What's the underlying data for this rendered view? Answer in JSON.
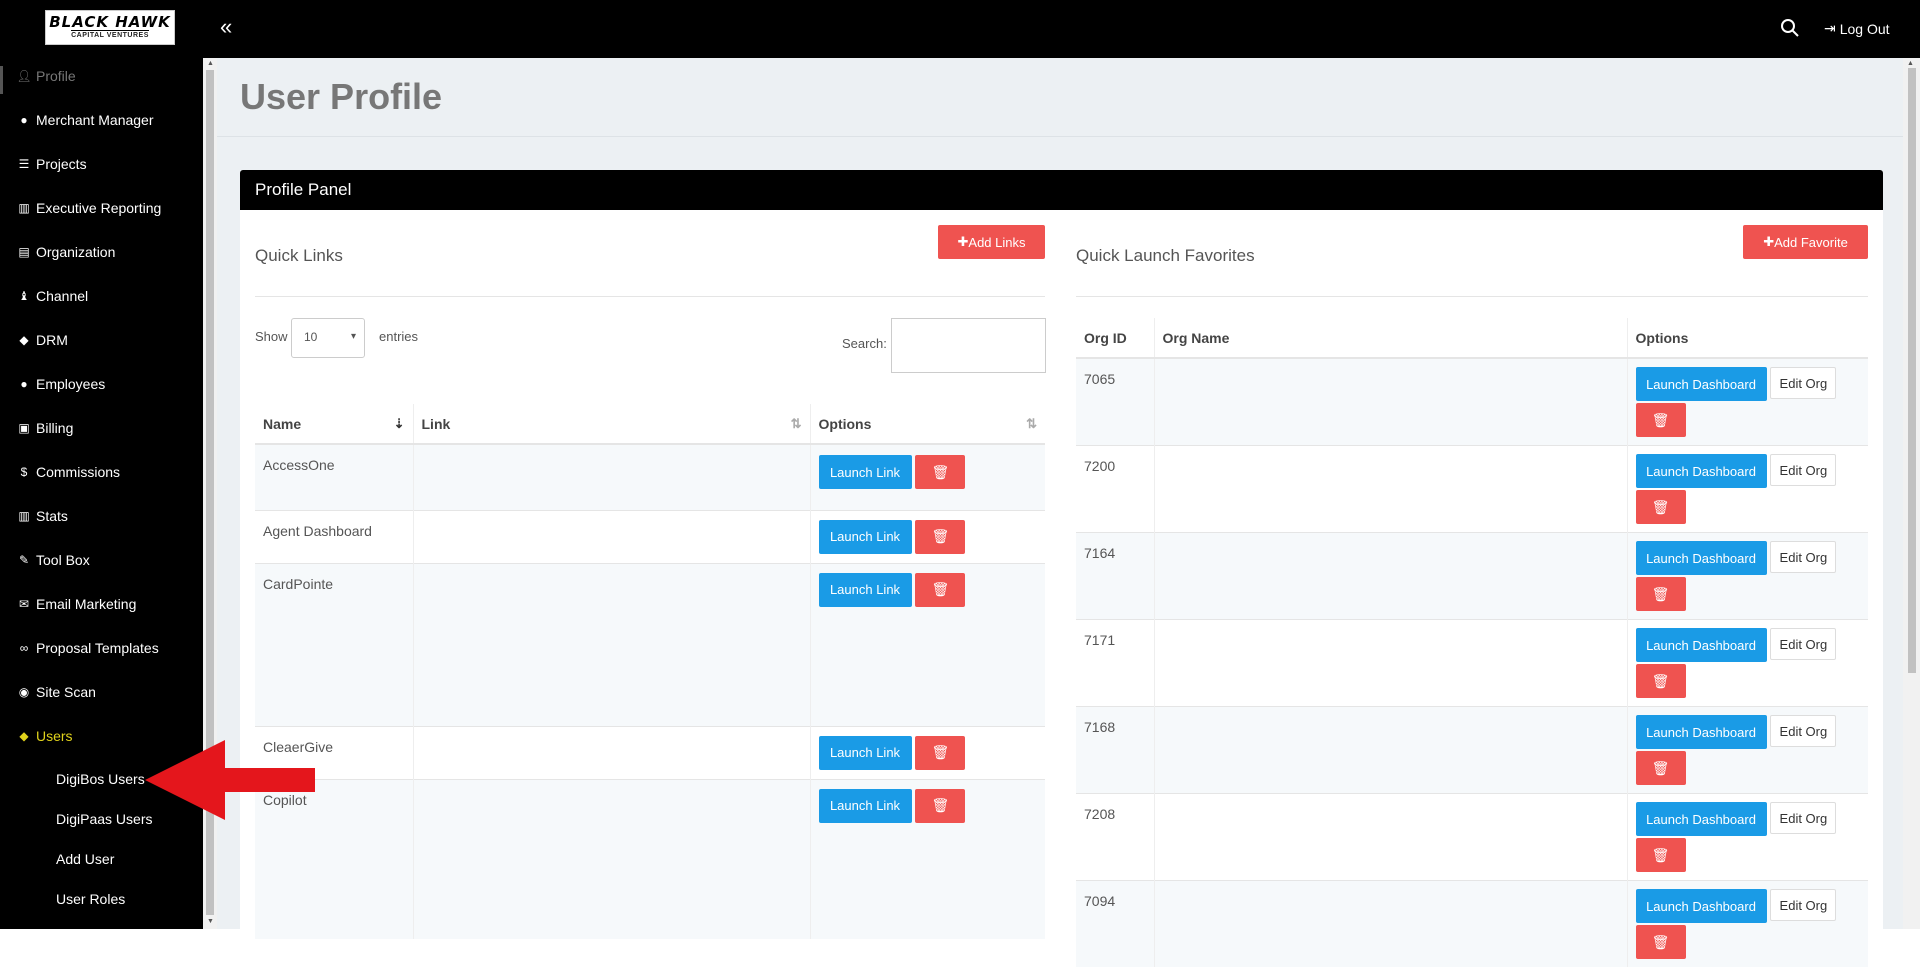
{
  "topbar": {
    "logo_line1": "BLACK HAWK",
    "logo_line2": "CAPITAL VENTURES",
    "collapse_glyph": "«",
    "logout_label": "Log Out"
  },
  "sidebar": {
    "items": [
      {
        "label": "Profile",
        "icon": "user-icon"
      },
      {
        "label": "Merchant Manager",
        "icon": "user-icon"
      },
      {
        "label": "Projects",
        "icon": "tasks-icon"
      },
      {
        "label": "Executive Reporting",
        "icon": "bar-chart-icon"
      },
      {
        "label": "Organization",
        "icon": "building-icon"
      },
      {
        "label": "Channel",
        "icon": "chess-icon"
      },
      {
        "label": "DRM",
        "icon": "users-icon"
      },
      {
        "label": "Employees",
        "icon": "user-icon"
      },
      {
        "label": "Billing",
        "icon": "money-icon"
      },
      {
        "label": "Commissions",
        "icon": "dollar-icon"
      },
      {
        "label": "Stats",
        "icon": "bar-chart-icon"
      },
      {
        "label": "Tool Box",
        "icon": "wrench-icon"
      },
      {
        "label": "Email Marketing",
        "icon": "envelope-icon"
      },
      {
        "label": "Proposal Templates",
        "icon": "handshake-icon"
      },
      {
        "label": "Site Scan",
        "icon": "globe-icon"
      },
      {
        "label": "Users",
        "icon": "users-icon"
      }
    ],
    "sub_items": [
      "DigiBos Users",
      "DigiPaas Users",
      "Add User",
      "User Roles"
    ]
  },
  "page": {
    "title": "User Profile",
    "panel_title": "Profile Panel"
  },
  "quick_links": {
    "title": "Quick Links",
    "add_label": "Add Links",
    "show_label": "Show",
    "entries_value": "10",
    "entries_label": "entries",
    "search_label": "Search:",
    "columns": [
      "Name",
      "Link",
      "Options"
    ],
    "launch_label": "Launch Link",
    "rows": [
      "AccessOne",
      "Agent Dashboard",
      "CardPointe",
      "CleaerGive",
      "Copilot"
    ]
  },
  "favorites": {
    "title": "Quick Launch Favorites",
    "add_label": "Add Favorite",
    "columns": [
      "Org ID",
      "Org Name",
      "Options"
    ],
    "launch_label": "Launch Dashboard",
    "edit_label": "Edit Org",
    "rows": [
      "7065",
      "7200",
      "7164",
      "7171",
      "7168",
      "7208",
      "7094"
    ]
  },
  "colors": {
    "accent_blue": "#1a9be6",
    "danger_red": "#ef5350",
    "sidebar_bg": "#000000",
    "users_highlight": "#e0d21b"
  }
}
